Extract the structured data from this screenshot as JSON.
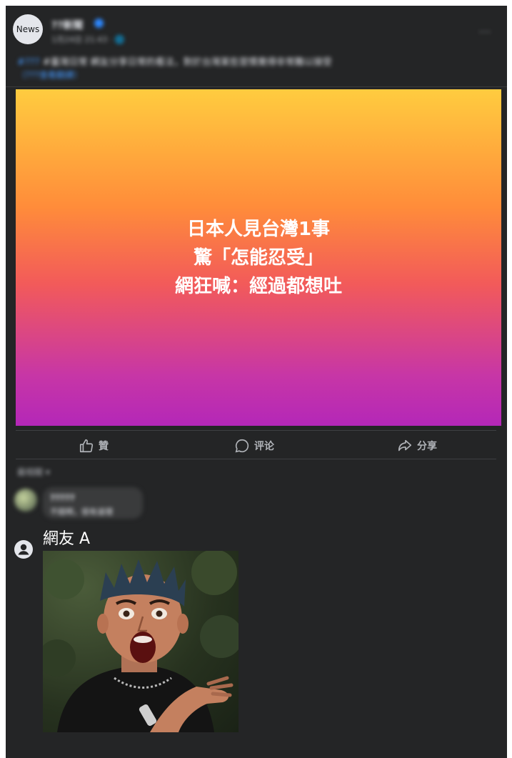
{
  "post": {
    "avatar_text": "News",
    "page_name": "??新聞",
    "meta": "1月24日 21:43 · 🌐",
    "more": "···",
    "caption": "#臺灣日常 網友分享日常的看法，對於台灣某些習慣覺得非常難以接受",
    "hashtag": "#???",
    "see_translation": "（???查看翻譯）"
  },
  "banner": {
    "lines": [
      "日本人見台灣1事",
      "驚「怎能忍受」",
      "網狂喊：經過都想吐"
    ],
    "colors": [
      "#ffcc3f",
      "#ff8c3a",
      "#f25a5a",
      "#b427b8"
    ]
  },
  "actions": {
    "like": "贊",
    "comment": "评论",
    "share": "分享"
  },
  "comments": {
    "sort_label": "最相關 ▾",
    "first": {
      "name": "?????",
      "text": "不錯啊，很有道理"
    },
    "second": {
      "name": "網友 A",
      "image_desc": "reaction-meme"
    }
  }
}
